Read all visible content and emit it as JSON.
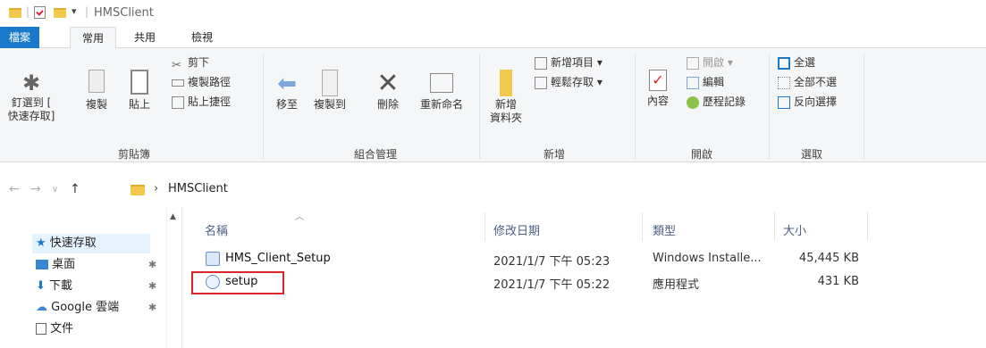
{
  "window": {
    "title": "HMSClient"
  },
  "tabs": [
    "檔案",
    "常用",
    "共用",
    "檢視"
  ],
  "ribbon": {
    "clipboard": {
      "pin_label_1": "釘選到 [",
      "pin_label_2": "快速存取]",
      "copy": "複製",
      "paste": "貼上",
      "cut": "剪下",
      "copy_path": "複製路徑",
      "paste_shortcut": "貼上捷徑",
      "group": "剪貼簿"
    },
    "organize": {
      "move_to": "移至",
      "copy_to": "複製到",
      "delete": "刪除",
      "rename": "重新命名",
      "group": "組合管理"
    },
    "new": {
      "new_folder_1": "新增",
      "new_folder_2": "資料夾",
      "new_item": "新增項目 ▾",
      "easy_access": "輕鬆存取 ▾",
      "group": "新增"
    },
    "open": {
      "properties": "內容",
      "open": "開啟 ▾",
      "edit": "編輯",
      "history": "歷程記錄",
      "group": "開啟"
    },
    "select": {
      "select_all": "全選",
      "select_none": "全部不選",
      "invert": "反向選擇",
      "group": "選取"
    }
  },
  "address": {
    "path": "HMSClient"
  },
  "nav": {
    "quick_access": "快速存取",
    "desktop": "桌面",
    "downloads": "下載",
    "google": "Google 雲端",
    "documents": "文件"
  },
  "columns": {
    "name": "名稱",
    "date": "修改日期",
    "type": "類型",
    "size": "大小"
  },
  "files": [
    {
      "name": "HMS_Client_Setup",
      "date": "2021/1/7 下午 05:23",
      "type": "Windows Installe...",
      "size": "45,445 KB"
    },
    {
      "name": "setup",
      "date": "2021/1/7 下午 05:22",
      "type": "應用程式",
      "size": "431 KB"
    }
  ],
  "colors": {
    "file_tab": "#1979ca",
    "highlight": "#d9262b",
    "selection": "#e5f3ff"
  }
}
